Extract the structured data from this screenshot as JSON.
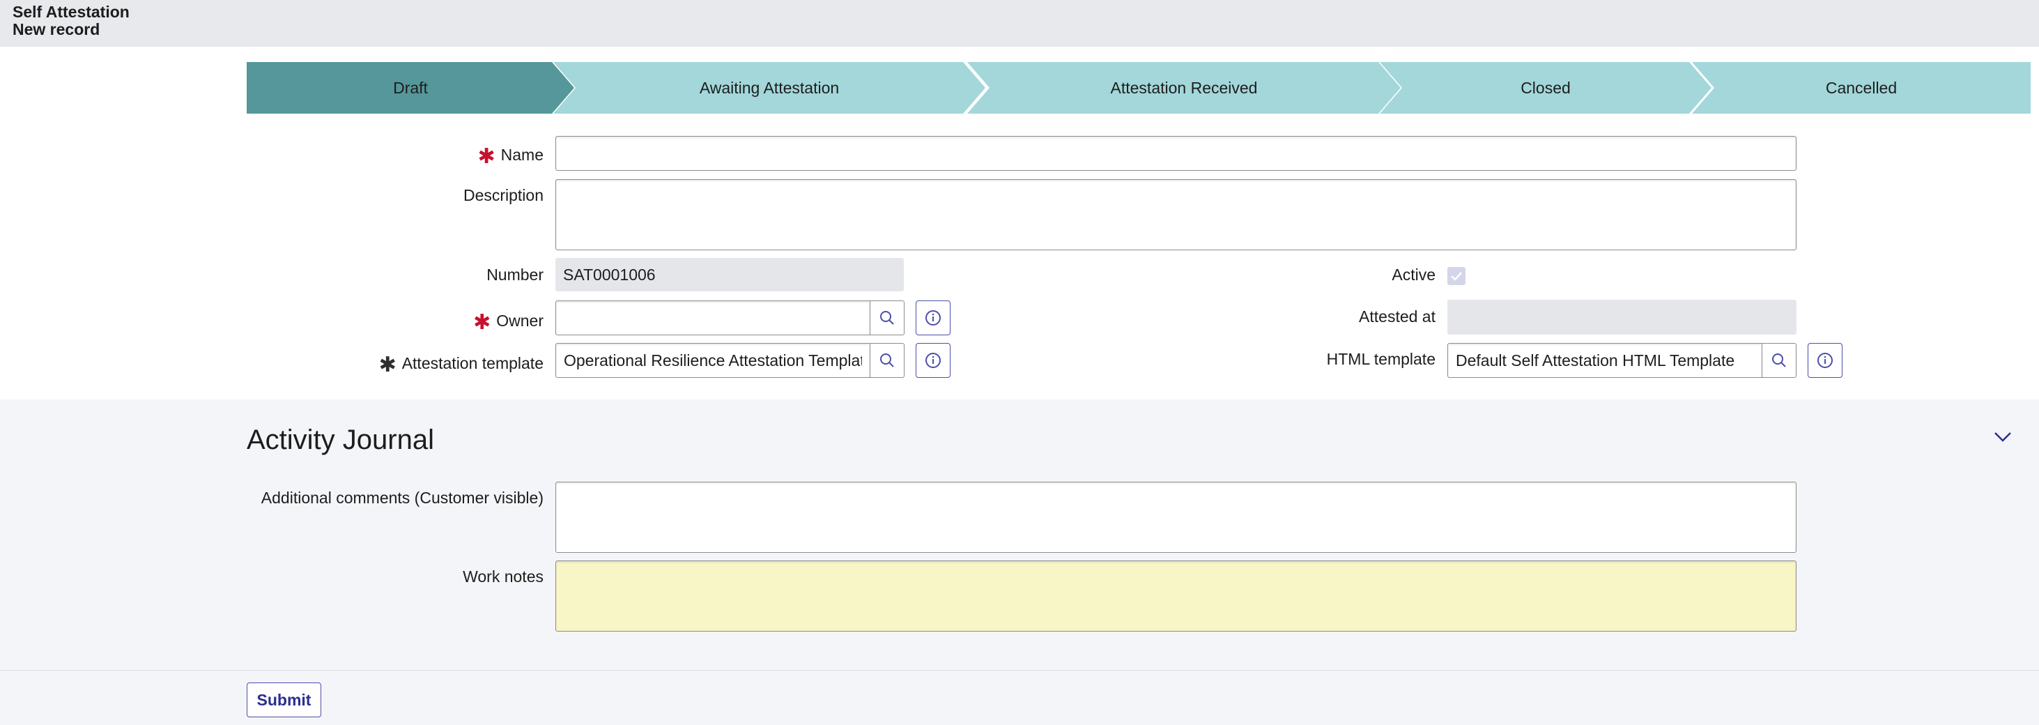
{
  "header": {
    "title": "Self Attestation",
    "subtitle": "New record"
  },
  "stages": [
    {
      "label": "Draft",
      "active": true
    },
    {
      "label": "Awaiting Attestation",
      "active": false
    },
    {
      "label": "Attestation Received",
      "active": false
    },
    {
      "label": "Closed",
      "active": false
    },
    {
      "label": "Cancelled",
      "active": false
    }
  ],
  "colors": {
    "stage_active": "#55979a",
    "stage_inactive": "#a3d7da",
    "required": "#c8102e",
    "accent": "#4a4fa8",
    "work_notes_bg": "#f8f5c6"
  },
  "form": {
    "name": {
      "label": "Name",
      "value": ""
    },
    "description": {
      "label": "Description",
      "value": ""
    },
    "number": {
      "label": "Number",
      "value": "SAT0001006"
    },
    "owner": {
      "label": "Owner",
      "value": ""
    },
    "attestation_template": {
      "label": "Attestation template",
      "value": "Operational Resilience Attestation Template"
    },
    "active": {
      "label": "Active",
      "checked": true
    },
    "attested_at": {
      "label": "Attested at",
      "value": ""
    },
    "html_template": {
      "label": "HTML template",
      "value": "Default Self Attestation HTML Template"
    }
  },
  "activity": {
    "title": "Activity Journal",
    "additional_comments": {
      "label": "Additional comments (Customer visible)",
      "value": ""
    },
    "work_notes": {
      "label": "Work notes",
      "value": ""
    }
  },
  "footer": {
    "submit_label": "Submit"
  },
  "icons": {
    "lookup": "search-icon",
    "info": "info-icon",
    "collapse": "chevron-down-icon",
    "required": "asterisk-icon"
  }
}
